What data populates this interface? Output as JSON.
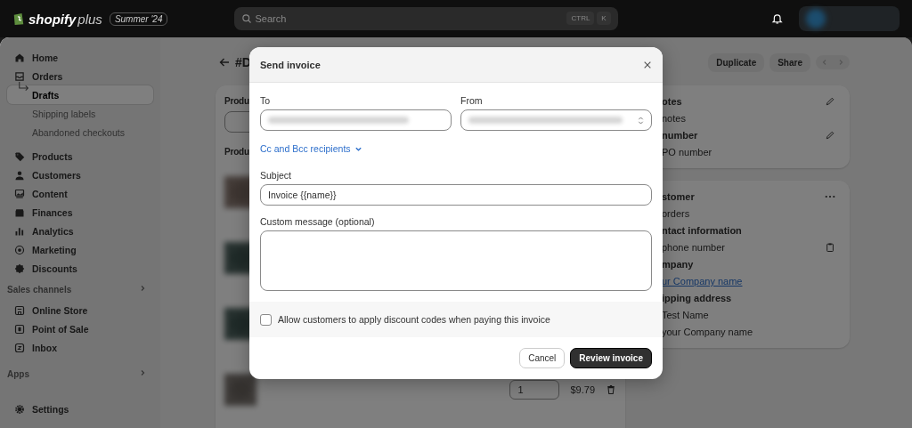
{
  "topbar": {
    "logo": "shopify",
    "logo_suffix": "plus",
    "edition": "Summer '24",
    "search": {
      "placeholder": "Search"
    },
    "shortcut": [
      "CTRL",
      "K"
    ]
  },
  "sidebar": {
    "items": [
      {
        "label": "Home",
        "selected": false
      },
      {
        "label": "Orders",
        "selected": false,
        "children": [
          {
            "label": "Drafts",
            "selected": true
          },
          {
            "label": "Shipping labels",
            "selected": false
          },
          {
            "label": "Abandoned checkouts",
            "selected": false
          }
        ]
      },
      {
        "label": "Products",
        "selected": false
      },
      {
        "label": "Customers",
        "selected": false
      },
      {
        "label": "Content",
        "selected": false
      },
      {
        "label": "Finances",
        "selected": false
      },
      {
        "label": "Analytics",
        "selected": false
      },
      {
        "label": "Marketing",
        "selected": false
      },
      {
        "label": "Discounts",
        "selected": false
      }
    ],
    "sales_channels": {
      "title": "Sales channels",
      "items": [
        {
          "label": "Online Store"
        },
        {
          "label": "Point of Sale"
        },
        {
          "label": "Inbox"
        }
      ]
    },
    "apps": {
      "title": "Apps"
    },
    "settings": "Settings"
  },
  "page": {
    "title": "#D",
    "actions": [
      "Duplicate",
      "Share"
    ],
    "product_title": "Produ",
    "products_heading": "Produ",
    "quantity": "1",
    "price": "$9.79",
    "side_cards": [
      {
        "lines": [
          {
            "text": "otes",
            "kind": "heading"
          },
          {
            "text": "notes",
            "kind": "text"
          },
          {
            "text": "number",
            "kind": "heading"
          },
          {
            "text": "PO number",
            "kind": "text"
          }
        ]
      },
      {
        "lines": [
          {
            "text": "stomer",
            "kind": "heading"
          },
          {
            "text": "orders",
            "kind": "text"
          },
          {
            "text": "ntact information",
            "kind": "heading"
          },
          {
            "text": "phone number",
            "kind": "text"
          },
          {
            "text": "mpany",
            "kind": "heading"
          },
          {
            "text": "ur Company name",
            "kind": "link"
          },
          {
            "text": "ipping address",
            "kind": "heading"
          },
          {
            "text": "Test Name",
            "kind": "text"
          },
          {
            "text": "your Company name",
            "kind": "text"
          }
        ]
      }
    ]
  },
  "dialog": {
    "title": "Send invoice",
    "to_label": "To",
    "from_label": "From",
    "cc_link": "Cc and Bcc recipients",
    "subject_label": "Subject",
    "subject": "Invoice {{name}}",
    "message_label": "Custom message (optional)",
    "discount_option": {
      "label": "Allow customers to apply discount codes when paying this invoice",
      "checked": false
    },
    "buttons": [
      {
        "label": "Cancel",
        "kind": "secondary"
      },
      {
        "label": "Review invoice",
        "kind": "primary"
      }
    ]
  }
}
